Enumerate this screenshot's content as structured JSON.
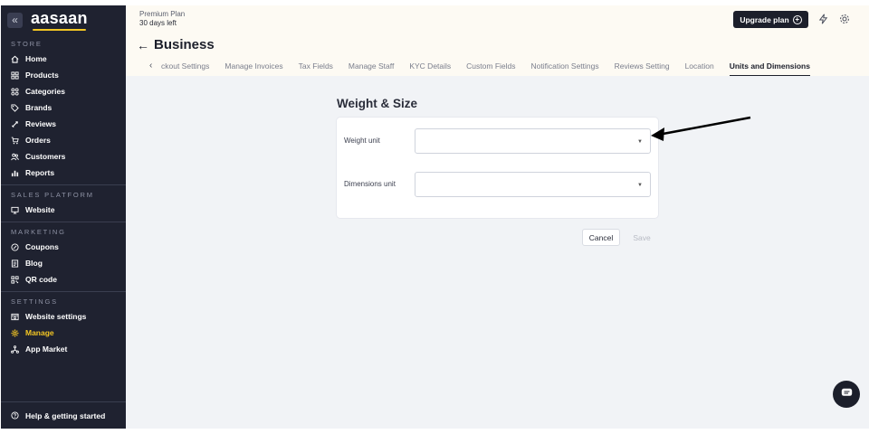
{
  "brand": {
    "logo_text": "aasaan"
  },
  "sidebar": {
    "collapse_glyph": "«",
    "sections": [
      {
        "label": "STORE",
        "items": [
          {
            "label": "Home",
            "icon": "home-icon"
          },
          {
            "label": "Products",
            "icon": "products-icon"
          },
          {
            "label": "Categories",
            "icon": "categories-icon"
          },
          {
            "label": "Brands",
            "icon": "tag-icon"
          },
          {
            "label": "Reviews",
            "icon": "reviews-icon"
          },
          {
            "label": "Orders",
            "icon": "cart-icon"
          },
          {
            "label": "Customers",
            "icon": "customers-icon"
          },
          {
            "label": "Reports",
            "icon": "reports-icon"
          }
        ]
      },
      {
        "label": "SALES PLATFORM",
        "items": [
          {
            "label": "Website",
            "icon": "monitor-icon"
          }
        ]
      },
      {
        "label": "MARKETING",
        "items": [
          {
            "label": "Coupons",
            "icon": "coupon-icon"
          },
          {
            "label": "Blog",
            "icon": "blog-icon"
          },
          {
            "label": "QR code",
            "icon": "qr-code-icon"
          }
        ]
      },
      {
        "label": "SETTINGS",
        "items": [
          {
            "label": "Website settings",
            "icon": "website-settings-icon"
          },
          {
            "label": "Manage",
            "icon": "gear-icon",
            "active": true
          },
          {
            "label": "App Market",
            "icon": "app-market-icon"
          }
        ]
      }
    ],
    "help_label": "Help & getting started"
  },
  "topbar": {
    "plan_name": "Premium Plan",
    "plan_days": "30 days left",
    "upgrade_label": "Upgrade plan"
  },
  "page": {
    "title": "Business",
    "tabs": [
      {
        "label": "ckout Settings"
      },
      {
        "label": "Manage Invoices"
      },
      {
        "label": "Tax Fields"
      },
      {
        "label": "Manage Staff"
      },
      {
        "label": "KYC Details"
      },
      {
        "label": "Custom Fields"
      },
      {
        "label": "Notification Settings"
      },
      {
        "label": "Reviews Setting"
      },
      {
        "label": "Location"
      },
      {
        "label": "Units and Dimensions",
        "active": true
      }
    ]
  },
  "form": {
    "title": "Weight & Size",
    "weight_label": "Weight unit",
    "weight_value": "",
    "dimensions_label": "Dimensions unit",
    "dimensions_value": "",
    "cancel_label": "Cancel",
    "save_label": "Save"
  },
  "colors": {
    "sidebar_bg": "#1f2230",
    "accent_yellow": "#f3c623",
    "topbar_bg": "#fdfaf3",
    "content_bg": "#f1f3f6",
    "dark_button": "#1c1f2b"
  }
}
